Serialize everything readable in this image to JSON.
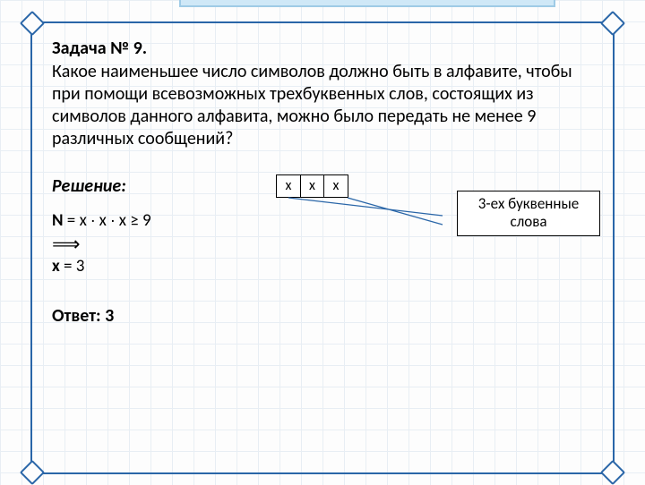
{
  "task": {
    "title": "Задача № 9.",
    "problem": "Какое наименьшее число символов должно быть в алфавите, чтобы при помощи всевозможных трехбуквенных слов, состоящих из символов данного алфавита, можно было передать не  менее 9 различных сообщений?"
  },
  "solution": {
    "label": "Решение:",
    "boxes": [
      "x",
      "x",
      "x"
    ],
    "callout_line1": "3-ех буквенные",
    "callout_line2": "слова",
    "formula": "N = x ∙ x ∙ x ≥ 9",
    "implication": "⟹",
    "result": "x = 3",
    "answer_label": "Ответ:",
    "answer_value": "3"
  }
}
